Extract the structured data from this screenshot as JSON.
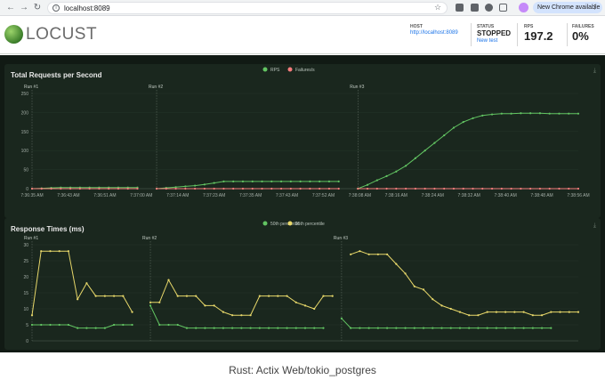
{
  "browser": {
    "url": "localhost:8089",
    "back_icon": "arrow-left",
    "forward_icon": "arrow-right",
    "reload_icon": "reload",
    "update_label": "New Chrome available"
  },
  "header": {
    "logo_text": "LOCUST",
    "host_label": "HOST",
    "host_value": "http://localhost:8089",
    "status_label": "STATUS",
    "status_value": "STOPPED",
    "new_test_label": "New test",
    "rps_label": "RPS",
    "rps_value": "197.2",
    "failures_label": "FAILURES",
    "failures_value": "0%"
  },
  "caption": "Rust: Actix Web/tokio_postgres",
  "chart_data": [
    {
      "type": "line",
      "title": "Total Requests per Second",
      "legend": [
        "RPS",
        "Failures/s"
      ],
      "legend_placement": "top-center",
      "colors": {
        "rps": "#62c462",
        "fail": "#f47c7c"
      },
      "ylim": [
        0,
        250
      ],
      "yticks": [
        "0",
        "50",
        "100",
        "150",
        "200",
        "250"
      ],
      "xticks": [
        "7:36:35 AM",
        "7:36:43 AM",
        "7:36:51 AM",
        "7:37:00 AM",
        "7:37:14 AM",
        "7:37:23 AM",
        "7:37:35 AM",
        "7:37:43 AM",
        "7:37:52 AM",
        "7:38:08 AM",
        "7:38:16 AM",
        "7:38:24 AM",
        "7:38:32 AM",
        "7:38:40 AM",
        "7:38:48 AM",
        "7:38:56 AM"
      ],
      "runs": [
        {
          "label": "Run #1",
          "start": 0
        },
        {
          "label": "Run #2",
          "start": 13
        },
        {
          "label": "Run #3",
          "start": 34
        }
      ],
      "series": [
        {
          "name": "RPS",
          "values": [
            0,
            1,
            2,
            3,
            3,
            3,
            3,
            3,
            3,
            3,
            3,
            3,
            null,
            0,
            2,
            4,
            6,
            8,
            11,
            15,
            19,
            19,
            19,
            19,
            19,
            19,
            19,
            19,
            19,
            19,
            19,
            19,
            19,
            null,
            0,
            10,
            22,
            33,
            45,
            60,
            80,
            100,
            120,
            140,
            160,
            175,
            185,
            192,
            195,
            197,
            197,
            198,
            198,
            198,
            197,
            197,
            197,
            197
          ]
        },
        {
          "name": "Failures/s",
          "values": [
            0,
            0,
            0,
            0,
            0,
            0,
            0,
            0,
            0,
            0,
            0,
            0,
            null,
            0,
            0,
            0,
            0,
            0,
            0,
            0,
            0,
            0,
            0,
            0,
            0,
            0,
            0,
            0,
            0,
            0,
            0,
            0,
            0,
            null,
            0,
            0,
            0,
            0,
            0,
            0,
            0,
            0,
            0,
            0,
            0,
            0,
            0,
            0,
            0,
            0,
            0,
            0,
            0,
            0,
            0,
            0,
            0,
            0
          ]
        }
      ]
    },
    {
      "type": "line",
      "title": "Response Times (ms)",
      "legend": [
        "50th percentile",
        "95th percentile"
      ],
      "legend_placement": "top-center",
      "colors": {
        "p50": "#62c462",
        "p95": "#e8d86a"
      },
      "ylim": [
        0,
        30
      ],
      "yticks": [
        "0",
        "5",
        "10",
        "15",
        "20",
        "25",
        "30"
      ],
      "runs": [
        {
          "label": "Run #1",
          "start": 0
        },
        {
          "label": "Run #2",
          "start": 13
        },
        {
          "label": "Run #3",
          "start": 34
        }
      ],
      "series": [
        {
          "name": "50th percentile",
          "values": [
            5,
            5,
            5,
            5,
            5,
            4,
            4,
            4,
            4,
            5,
            5,
            5,
            null,
            11,
            5,
            5,
            5,
            4,
            4,
            4,
            4,
            4,
            4,
            4,
            4,
            4,
            4,
            4,
            4,
            4,
            4,
            4,
            4,
            null,
            7,
            4,
            4,
            4,
            4,
            4,
            4,
            4,
            4,
            4,
            4,
            4,
            4,
            4,
            4,
            4,
            4,
            4,
            4,
            4,
            4,
            4,
            4,
            4
          ]
        },
        {
          "name": "95th percentile",
          "values": [
            8,
            28,
            28,
            28,
            28,
            13,
            18,
            14,
            14,
            14,
            14,
            9,
            null,
            12,
            12,
            19,
            14,
            14,
            14,
            11,
            11,
            9,
            8,
            8,
            8,
            14,
            14,
            14,
            14,
            12,
            11,
            10,
            14,
            14,
            null,
            27,
            28,
            27,
            27,
            27,
            24,
            21,
            17,
            16,
            13,
            11,
            10,
            9,
            8,
            8,
            9,
            9,
            9,
            9,
            9,
            8,
            8,
            9,
            9,
            9,
            9
          ]
        }
      ]
    }
  ]
}
